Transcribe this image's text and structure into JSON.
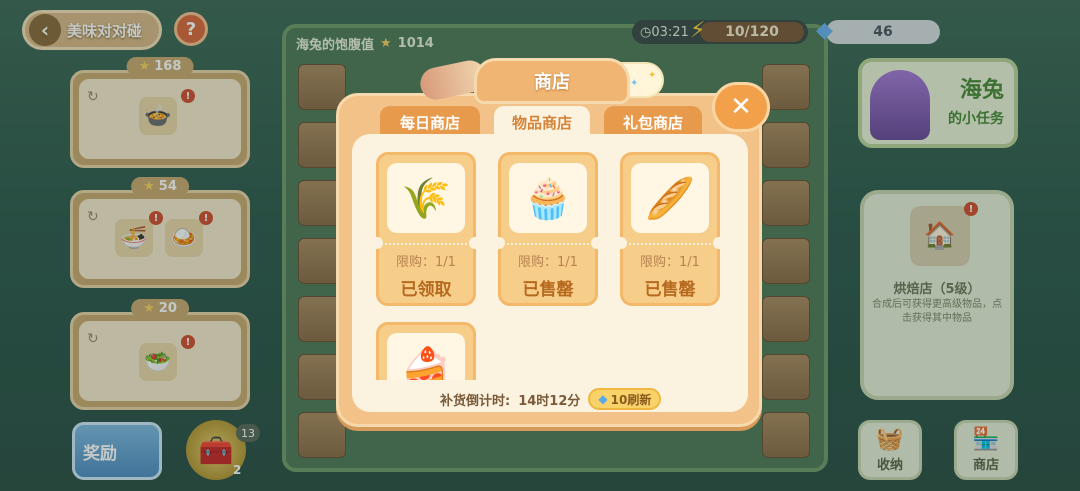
{
  "top_bar": {
    "title": "美味对对碰",
    "help": "?",
    "timer": "03:21",
    "energy": "10/120",
    "gems": "46"
  },
  "board": {
    "satiety_label": "海兔的饱腹值",
    "satiety_value": "1014"
  },
  "orders": [
    {
      "score": "168"
    },
    {
      "score": "54"
    },
    {
      "score": "20"
    }
  ],
  "reward_button": "奖励",
  "chest": {
    "count": "13",
    "sub": "2"
  },
  "quest": {
    "line1": "海兔",
    "line2": "的小任务"
  },
  "building": {
    "name": "烘焙店（5级）",
    "desc": "合成后可获得更高级物品，点击获得其中物品"
  },
  "side_buttons": {
    "storage": "收纳",
    "shop": "商店"
  },
  "shop": {
    "title": "商店",
    "tabs": [
      {
        "label": "每日商店",
        "active": false
      },
      {
        "label": "物品商店",
        "active": true
      },
      {
        "label": "礼包商店",
        "active": false
      }
    ],
    "items": [
      {
        "icon": "wheat-icon",
        "limit": "限购：1/1",
        "status": "已领取"
      },
      {
        "icon": "bread-icon",
        "limit": "限购：1/1",
        "status": "已售罄"
      },
      {
        "icon": "flour-icon",
        "limit": "限购：1/1",
        "status": "已售罄"
      },
      {
        "icon": "cupcake-icon",
        "limit": "",
        "status": ""
      }
    ],
    "restock_label": "补货倒计时:",
    "restock_time": "14时12分",
    "refresh_label": "10刷新"
  }
}
